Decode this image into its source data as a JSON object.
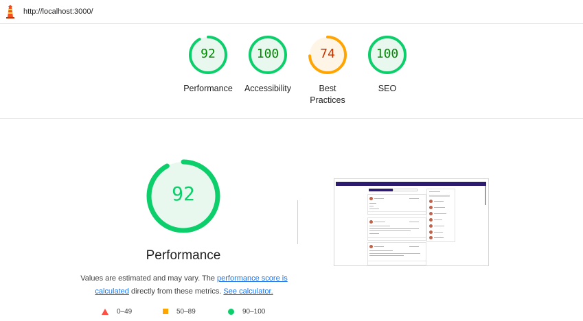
{
  "url": "http://localhost:3000/",
  "colors": {
    "pass": "#0cce6b",
    "average": "#ffa400",
    "fail": "#ff4e42",
    "pass_text": "#008800",
    "average_text": "#c33300"
  },
  "gauges": [
    {
      "score": "92",
      "label": "Performance",
      "level": 0.92,
      "status": "pass"
    },
    {
      "score": "100",
      "label": "Accessibility",
      "level": 1.0,
      "status": "pass"
    },
    {
      "score": "74",
      "label": "Best Practices",
      "level": 0.74,
      "status": "average"
    },
    {
      "score": "100",
      "label": "SEO",
      "level": 1.0,
      "status": "pass"
    }
  ],
  "main": {
    "score": "92",
    "level": 0.92,
    "title": "Performance",
    "desc_text_1": "Values are estimated and may vary. The ",
    "desc_link_1": "performance score is calculated",
    "desc_text_2": " directly from these metrics. ",
    "desc_link_2": "See calculator."
  },
  "legend": [
    {
      "range": "0–49",
      "icon": "triangle-icon"
    },
    {
      "range": "50–89",
      "icon": "square-icon"
    },
    {
      "range": "90–100",
      "icon": "circle-icon"
    }
  ]
}
